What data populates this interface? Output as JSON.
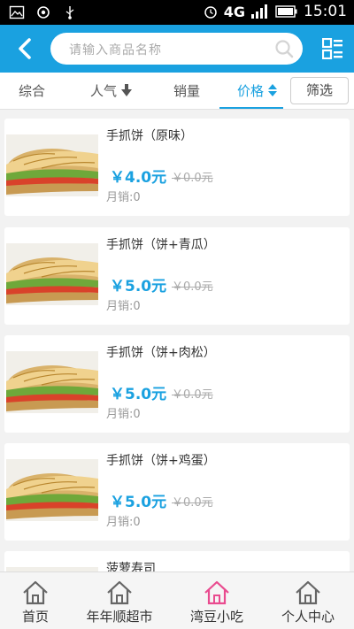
{
  "status_bar": {
    "network": "4G",
    "time": "15:01"
  },
  "header": {
    "search_placeholder": "请输入商品名称"
  },
  "sort_bar": {
    "items": [
      "综合",
      "人气",
      "销量",
      "价格"
    ],
    "active_index": 3,
    "filter_label": "筛选"
  },
  "products": [
    {
      "name": "手抓饼（原味）",
      "price": "￥4.0元",
      "original_price": "￥0.0元",
      "sales": "月销:0"
    },
    {
      "name": "手抓饼（饼+青瓜）",
      "price": "￥5.0元",
      "original_price": "￥0.0元",
      "sales": "月销:0"
    },
    {
      "name": "手抓饼（饼+肉松）",
      "price": "￥5.0元",
      "original_price": "￥0.0元",
      "sales": "月销:0"
    },
    {
      "name": "手抓饼（饼+鸡蛋）",
      "price": "￥5.0元",
      "original_price": "￥0.0元",
      "sales": "月销:0"
    },
    {
      "name": "菠萝寿司"
    }
  ],
  "bottom_nav": {
    "items": [
      {
        "label": "首页",
        "icon": "home-icon"
      },
      {
        "label": "年年顺超市",
        "icon": "home-icon"
      },
      {
        "label": "湾豆小吃",
        "icon": "home-icon"
      },
      {
        "label": "个人中心",
        "icon": "home-icon"
      }
    ],
    "active_index": 2
  },
  "colors": {
    "accent": "#1aa1e0",
    "active_nav_icon": "#e94b8f"
  }
}
